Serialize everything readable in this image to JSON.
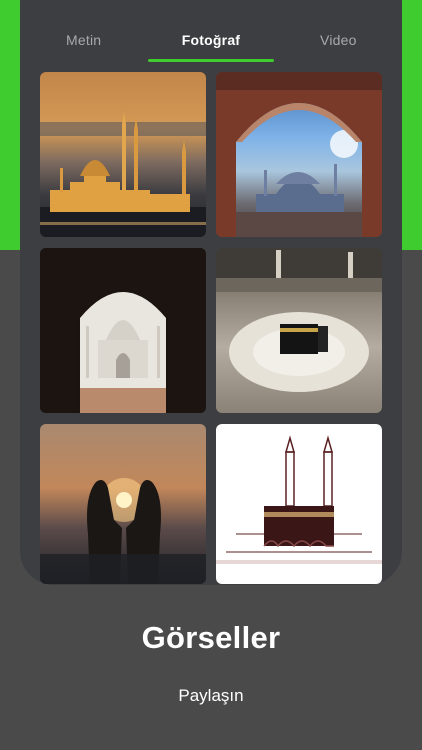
{
  "tabs": [
    {
      "label": "Metin",
      "active": false
    },
    {
      "label": "Fotoğraf",
      "active": true
    },
    {
      "label": "Video",
      "active": false
    }
  ],
  "gallery": [
    {
      "image": "mosque-sunset-image"
    },
    {
      "image": "mosque-arch-image"
    },
    {
      "image": "taj-mahal-arch-image"
    },
    {
      "image": "kaaba-crowd-image"
    },
    {
      "image": "praying-hands-sunset-image"
    },
    {
      "image": "kaaba-sketch-image"
    }
  ],
  "hero": {
    "title": "Görseller",
    "subtitle": "Paylaşın"
  },
  "colors": {
    "accent": "#3fcc2e",
    "background": "#4a4a4a",
    "panel": "#3c3e41"
  }
}
